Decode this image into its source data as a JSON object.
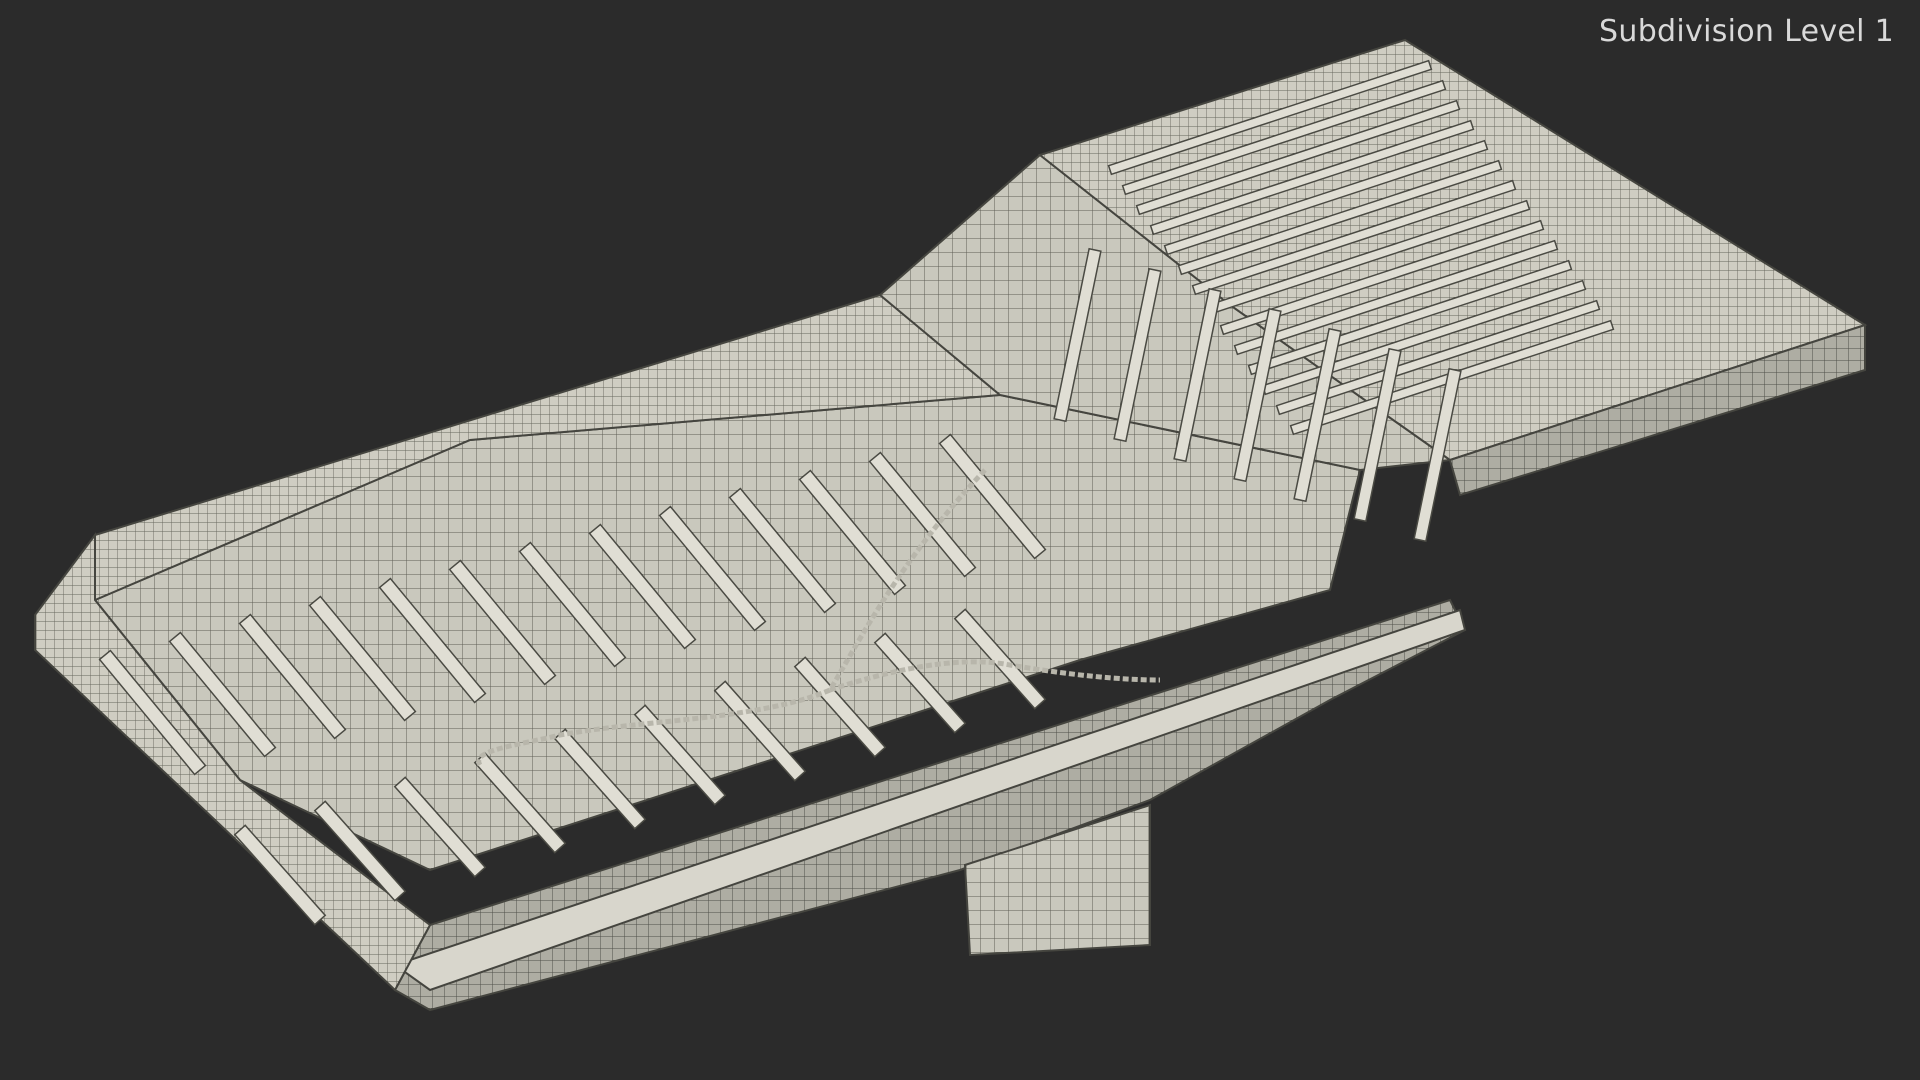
{
  "overlay": {
    "subdivision_label": "Subdivision Level 1"
  },
  "model": {
    "subject": "dump truck bed wireframe",
    "base_color": "#d4d2c8",
    "wire_color": "#55554c",
    "background_color": "#2b2b2b"
  }
}
